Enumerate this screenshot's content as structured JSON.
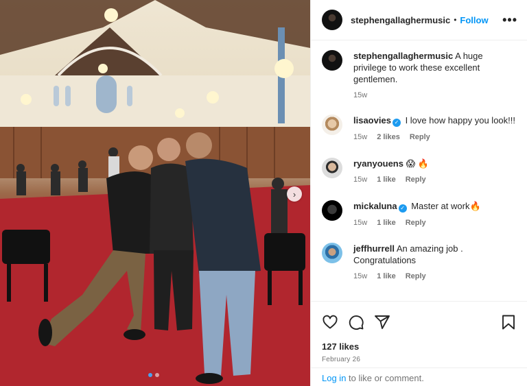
{
  "post": {
    "author": "stephengallaghermusic",
    "separator": "•",
    "follow_label": "Follow",
    "more_label": "•••",
    "caption": "A huge privilege to work these excellent gentlemen.",
    "caption_age": "15w",
    "likes": "127 likes",
    "date": "February 26"
  },
  "carousel": {
    "next_label": "›",
    "slides": 2,
    "current": 1
  },
  "comments": [
    {
      "user": "lisaovies",
      "verified": true,
      "text": "I love how happy you look!!!",
      "age": "15w",
      "likes": "2 likes",
      "reply": "Reply"
    },
    {
      "user": "ryanyouens",
      "verified": false,
      "text": "😱 🔥",
      "age": "15w",
      "likes": "1 like",
      "reply": "Reply"
    },
    {
      "user": "mickaluna",
      "verified": true,
      "text": "Master at work🔥",
      "age": "15w",
      "likes": "1 like",
      "reply": "Reply"
    },
    {
      "user": "jeffhurrell",
      "verified": false,
      "text": "An amazing job . Congratulations",
      "age": "15w",
      "likes": "1 like",
      "reply": "Reply"
    }
  ],
  "footer": {
    "login_link": "Log in",
    "login_rest": " to like or comment."
  },
  "icons": {
    "like": "heart-icon",
    "comment": "comment-icon",
    "share": "share-icon",
    "save": "bookmark-icon",
    "verified": "verified-badge-icon",
    "next": "chevron-right-icon"
  },
  "colors": {
    "accent": "#0095f6",
    "verified": "#1d9bf0",
    "muted": "#737373",
    "carpet": "#b1262e"
  }
}
